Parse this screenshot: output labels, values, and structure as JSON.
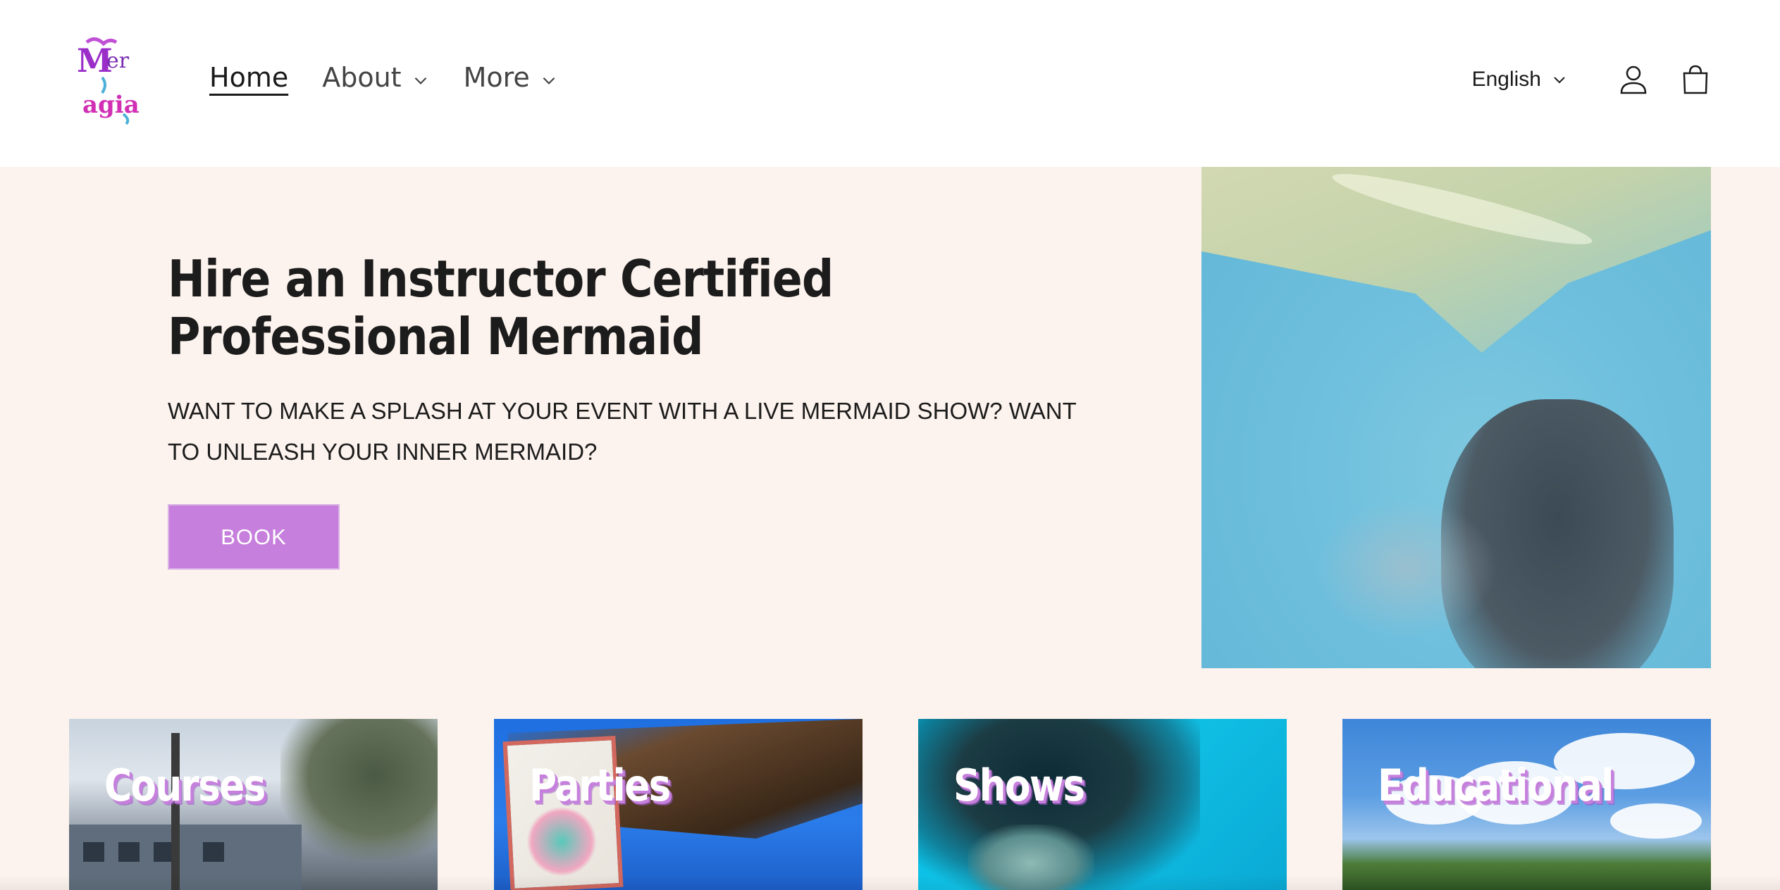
{
  "header": {
    "logo_alt": "Mer agia",
    "nav": [
      {
        "label": "Home",
        "active": true
      },
      {
        "label": "About",
        "has_dropdown": true
      },
      {
        "label": "More",
        "has_dropdown": true
      }
    ],
    "language": "English",
    "icons": [
      "account-icon",
      "cart-icon"
    ]
  },
  "hero": {
    "title": "Hire an Instructor Certified Professional Mermaid",
    "subtitle": "WANT TO MAKE A SPLASH AT YOUR EVENT WITH A LIVE MERMAID SHOW? WANT TO UNLEASH YOUR INNER MERMAID?",
    "cta_label": "BOOK"
  },
  "categories": [
    {
      "label": "Courses"
    },
    {
      "label": "Parties"
    },
    {
      "label": "Shows"
    },
    {
      "label": "Educational"
    }
  ],
  "colors": {
    "accent": "#c67fdc",
    "hero_background": "#fdf3ee",
    "text": "#1c1c1c"
  }
}
